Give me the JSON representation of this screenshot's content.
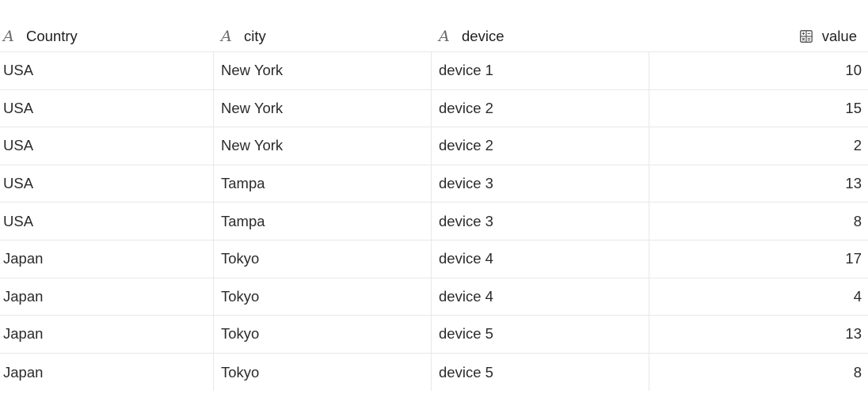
{
  "columns": {
    "country": {
      "label": "Country",
      "icon": "text-type-icon",
      "glyph": "A"
    },
    "city": {
      "label": "city",
      "icon": "text-type-icon",
      "glyph": "A"
    },
    "device": {
      "label": "device",
      "icon": "text-type-icon",
      "glyph": "A"
    },
    "value": {
      "label": "value",
      "icon": "number-type-icon"
    }
  },
  "rows": [
    {
      "country": "USA",
      "city": "New York",
      "device": "device 1",
      "value": "10"
    },
    {
      "country": "USA",
      "city": "New York",
      "device": "device 2",
      "value": "15"
    },
    {
      "country": "USA",
      "city": "New York",
      "device": "device 2",
      "value": "2"
    },
    {
      "country": "USA",
      "city": "Tampa",
      "device": "device 3",
      "value": "13"
    },
    {
      "country": "USA",
      "city": "Tampa",
      "device": "device 3",
      "value": "8"
    },
    {
      "country": "Japan",
      "city": "Tokyo",
      "device": "device 4",
      "value": "17"
    },
    {
      "country": "Japan",
      "city": "Tokyo",
      "device": "device 4",
      "value": "4"
    },
    {
      "country": "Japan",
      "city": "Tokyo",
      "device": "device 5",
      "value": "13"
    },
    {
      "country": "Japan",
      "city": "Tokyo",
      "device": "device 5",
      "value": "8"
    }
  ]
}
